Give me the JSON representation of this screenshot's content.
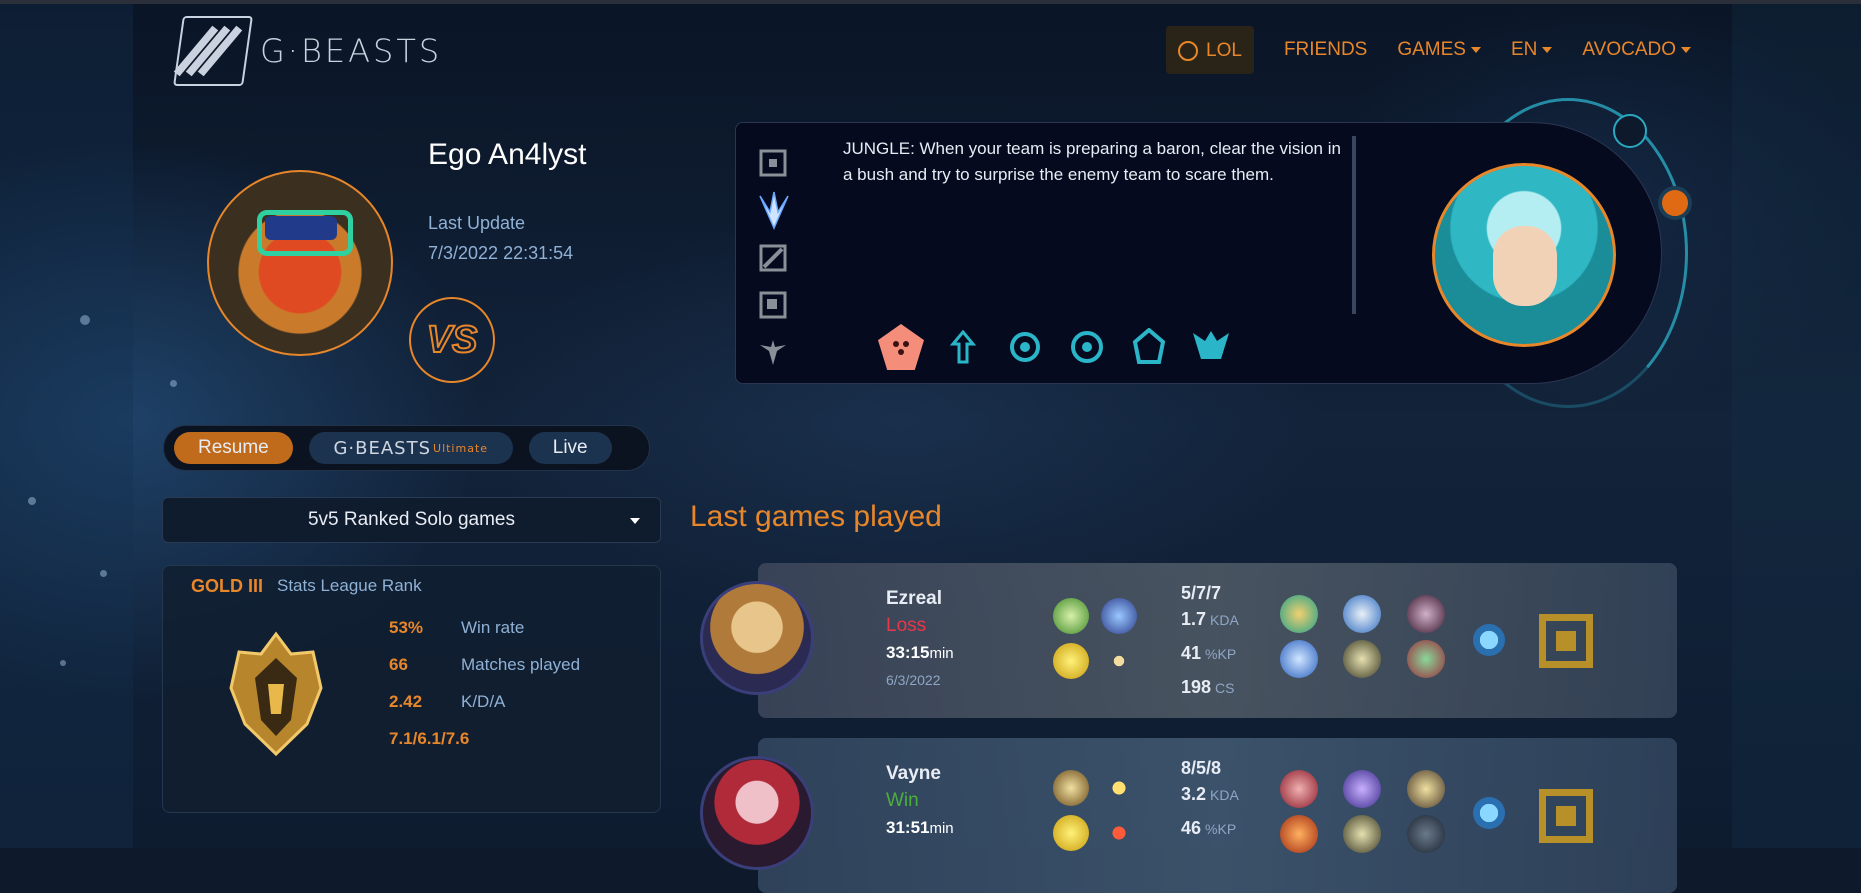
{
  "nav": {
    "brand": "G·BEASTS",
    "items": [
      {
        "label": "LOL",
        "active": true
      },
      {
        "label": "FRIENDS"
      },
      {
        "label": "GAMES",
        "dropdown": true
      },
      {
        "label": "EN",
        "dropdown": true
      },
      {
        "label": "AVOCADO",
        "dropdown": true
      }
    ]
  },
  "profile": {
    "name": "Ego An4lyst",
    "last_update_label": "Last Update",
    "last_update_value": "7/3/2022 22:31:54",
    "vs_label": "VS"
  },
  "tabs": {
    "resume": "Resume",
    "beasts": "G·BEASTS",
    "beasts_sup": "Ultimate",
    "live": "Live"
  },
  "queue_select": {
    "value": "5v5 Ranked Solo games"
  },
  "stats": {
    "rank": "GOLD III",
    "rank_label": "Stats League Rank",
    "rows": [
      {
        "value": "53%",
        "label": "Win rate"
      },
      {
        "value": "66",
        "label": "Matches played"
      },
      {
        "value": "2.42",
        "label": "K/D/A"
      },
      {
        "value": "7.1/6.1/7.6",
        "label": ""
      }
    ]
  },
  "tip": {
    "text": "JUNGLE:   When your team is preparing a baron, clear the vision in a bush and try to surprise the enemy team to scare them.",
    "roles": [
      "top-lane-icon",
      "jungle-icon",
      "mid-lane-icon",
      "bot-lane-icon",
      "support-icon"
    ],
    "champions": [
      "champion-icon-1",
      "champion-icon-2",
      "champion-icon-3",
      "champion-icon-4",
      "champion-icon-5",
      "champion-icon-6"
    ]
  },
  "last_games": {
    "title": "Last games played",
    "matches": [
      {
        "champion": "Ezreal",
        "result": "Loss",
        "duration": "33:15",
        "duration_unit": "min",
        "date": "6/3/2022",
        "kda_raw": "5/7/7",
        "kda": "1.7",
        "kda_unit": "KDA",
        "kp": "41",
        "kp_unit": "%KP",
        "cs": "198",
        "cs_unit": "CS",
        "result_color": "#e8364a"
      },
      {
        "champion": "Vayne",
        "result": "Win",
        "duration": "31:51",
        "duration_unit": "min",
        "date": "",
        "kda_raw": "8/5/8",
        "kda": "3.2",
        "kda_unit": "KDA",
        "kp": "46",
        "kp_unit": "%KP",
        "cs": "",
        "cs_unit": "",
        "result_color": "#4caf3c"
      }
    ]
  }
}
